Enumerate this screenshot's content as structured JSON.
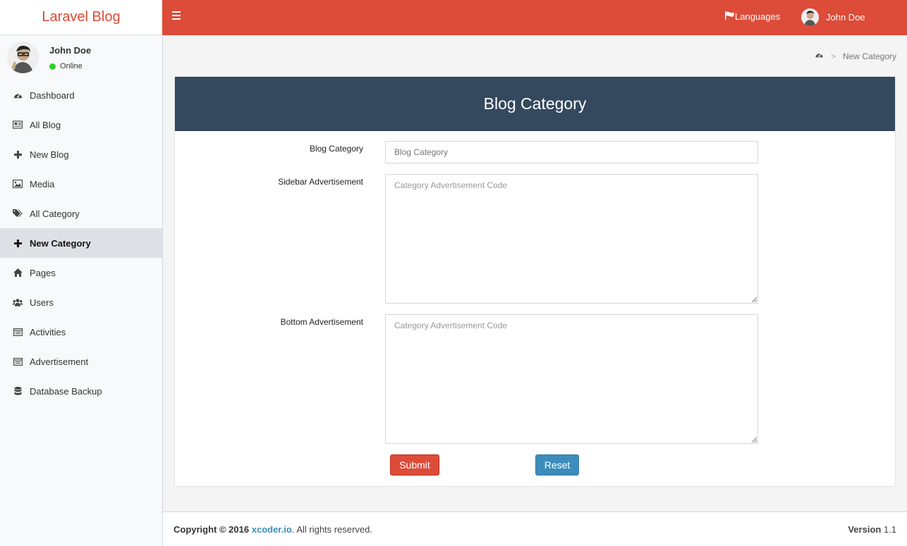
{
  "app": {
    "title": "Laravel Blog"
  },
  "header": {
    "languages": "Languages",
    "user_name": "John Doe"
  },
  "sidebar": {
    "user": {
      "name": "John Doe",
      "status": "Online"
    },
    "items": [
      {
        "label": "Dashboard",
        "icon": "dashboard-icon"
      },
      {
        "label": "All Blog",
        "icon": "newspaper-icon"
      },
      {
        "label": "New Blog",
        "icon": "plus-icon"
      },
      {
        "label": "Media",
        "icon": "image-icon"
      },
      {
        "label": "All Category",
        "icon": "tags-icon"
      },
      {
        "label": "New Category",
        "icon": "plus-icon",
        "active": true
      },
      {
        "label": "Pages",
        "icon": "home-icon"
      },
      {
        "label": "Users",
        "icon": "users-icon"
      },
      {
        "label": "Activities",
        "icon": "list-icon"
      },
      {
        "label": "Advertisement",
        "icon": "list-icon"
      },
      {
        "label": "Database Backup",
        "icon": "database-icon"
      }
    ]
  },
  "breadcrumb": {
    "sep": ">",
    "current": "New Category"
  },
  "form": {
    "title": "Blog Category",
    "category_label": "Blog Category",
    "category_placeholder": "Blog Category",
    "sidebar_ad_label": "Sidebar Advertisement",
    "sidebar_ad_placeholder": "Category Advertisement Code",
    "bottom_ad_label": "Bottom Advertisement",
    "bottom_ad_placeholder": "Category Advertisement Code",
    "submit_label": "Submit",
    "reset_label": "Reset"
  },
  "footer": {
    "copyright_prefix": "Copyright © 2016",
    "link_text": "xcoder.io",
    "rights": ". All rights reserved.",
    "version_label": "Version",
    "version_value": "1.1"
  },
  "colors": {
    "header": "#dd4b39",
    "box_head": "#34495e",
    "reset": "#3c8dbc"
  }
}
